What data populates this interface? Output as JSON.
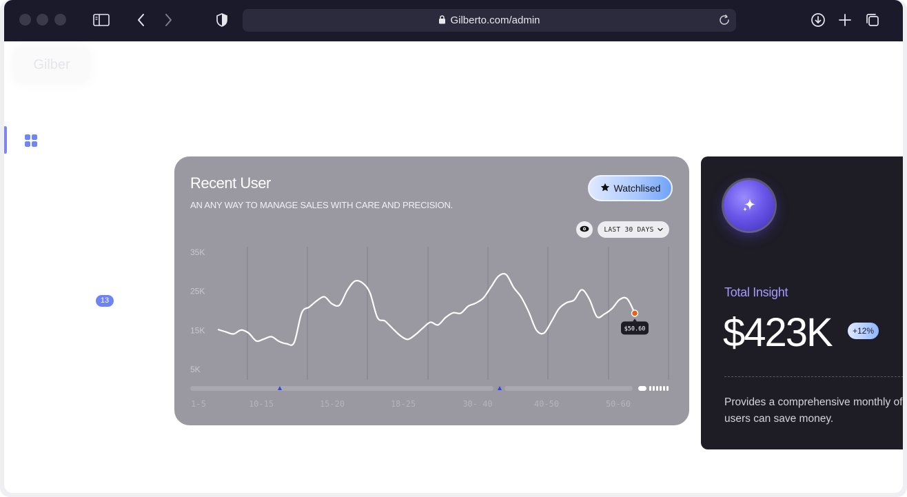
{
  "browser": {
    "url": "Gilberto.com/admin"
  },
  "sidebar": {
    "logo": "Gilber",
    "badge_count": "13"
  },
  "recent_user_card": {
    "title": "Recent User",
    "subtitle": "AN ANY WAY TO MANAGE SALES WITH CARE AND PRECISION.",
    "watchlist_label": "Watchlised",
    "range_label": "LAST 30 DAYS"
  },
  "chart_data": {
    "type": "line",
    "y_ticks": [
      "35K",
      "25K",
      "15K",
      "5K"
    ],
    "y_tick_values": [
      35000,
      25000,
      15000,
      5000
    ],
    "x_ticks": [
      "1-5",
      "10-15",
      "15-20",
      "18-25",
      "30- 40",
      "40-50",
      "50-60"
    ],
    "ylim": [
      3500,
      35000
    ],
    "xlim": [
      0,
      100
    ],
    "grid": "vertical",
    "series": [
      {
        "values": [
          [
            0,
            15200
          ],
          [
            2,
            14600
          ],
          [
            4,
            14100
          ],
          [
            6,
            15100
          ],
          [
            8,
            14300
          ],
          [
            10,
            12300
          ],
          [
            12,
            12800
          ],
          [
            14,
            13400
          ],
          [
            16,
            12200
          ],
          [
            18,
            11600
          ],
          [
            20,
            11900
          ],
          [
            22,
            19500
          ],
          [
            24,
            21000
          ],
          [
            26,
            22600
          ],
          [
            28,
            23600
          ],
          [
            30,
            21800
          ],
          [
            32,
            21500
          ],
          [
            34,
            25200
          ],
          [
            36,
            27600
          ],
          [
            38,
            27200
          ],
          [
            40,
            24700
          ],
          [
            42,
            18300
          ],
          [
            44,
            17400
          ],
          [
            46,
            15500
          ],
          [
            48,
            13700
          ],
          [
            50,
            12700
          ],
          [
            52,
            13900
          ],
          [
            54,
            15600
          ],
          [
            56,
            17100
          ],
          [
            58,
            16400
          ],
          [
            60,
            18300
          ],
          [
            62,
            19500
          ],
          [
            64,
            19400
          ],
          [
            66,
            21200
          ],
          [
            68,
            22000
          ],
          [
            70,
            23300
          ],
          [
            72,
            26100
          ],
          [
            74,
            28900
          ],
          [
            76,
            29300
          ],
          [
            78,
            26000
          ],
          [
            80,
            23500
          ],
          [
            82,
            19700
          ],
          [
            84,
            15100
          ],
          [
            86,
            14300
          ],
          [
            88,
            17300
          ],
          [
            90,
            20600
          ],
          [
            92,
            22100
          ],
          [
            94,
            22800
          ],
          [
            96,
            25400
          ],
          [
            98,
            23000
          ],
          [
            100,
            18500
          ],
          [
            102,
            19200
          ],
          [
            104,
            20600
          ],
          [
            106,
            22900
          ],
          [
            108,
            23100
          ],
          [
            110,
            19400
          ]
        ]
      }
    ],
    "tooltip": "$50.60",
    "scrubber_markers": 2
  },
  "insight_card": {
    "label": "Total Insight",
    "value": "$423K",
    "change_badge": "+12%",
    "description_line1": "Provides a comprehensive monthly of",
    "description_line2": "users can save money."
  },
  "colors": {
    "accent": "#7c86f0",
    "insight_label": "#a79bff",
    "marker_dot": "#e8620f",
    "card_bg": "#9a99a2",
    "dark_card_bg": "#1e1d26"
  }
}
